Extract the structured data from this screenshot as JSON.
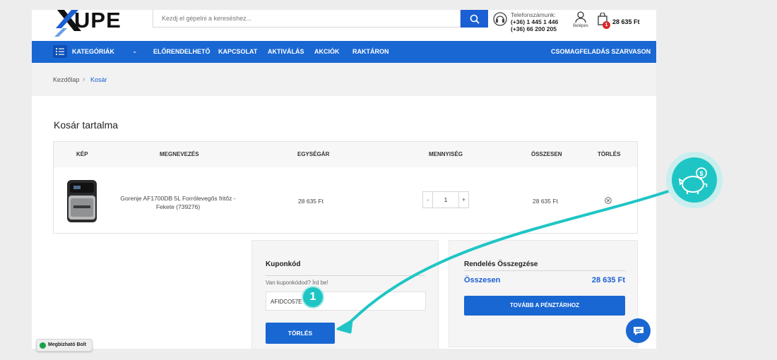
{
  "header": {
    "logo_text": "UPE",
    "search_placeholder": "Kezdj el gépelni a kereséshez...",
    "phone_label": "Telefonszámunk:",
    "phone_1": "(+36) 1 445 1 446",
    "phone_2": "(+36) 66 200 205",
    "login_label": "Belépés",
    "cart_count": "1",
    "cart_total": "28 635 Ft"
  },
  "nav": {
    "categories": "KATEGÓRIÁK",
    "items": [
      "ELŐRENDELHETŐ",
      "KAPCSOLAT",
      "AKTIVÁLÁS",
      "AKCIÓK",
      "RAKTÁRON"
    ],
    "right": "CSOMAGFELADÁS SZARVASON"
  },
  "breadcrumb": {
    "home": "Kezdőlap",
    "current": "Kosár"
  },
  "cart": {
    "title": "Kosár tartalma",
    "columns": [
      "KÉP",
      "MEGNEVEZÉS",
      "EGYSÉGÁR",
      "MENNYISÉG",
      "ÖSSZESEN",
      "TÖRLÉS"
    ],
    "rows": [
      {
        "name_line1": "Gorenje AF1700DB 5L Forrólevegős fritőz -",
        "name_line2": "Fekete (739276)",
        "unit_price": "28 635 Ft",
        "quantity": "1",
        "total": "28 635 Ft"
      }
    ]
  },
  "coupon": {
    "heading": "Kuponkód",
    "hint": "Van kuponkódod? Írd be!",
    "code": "AFIDCO57E",
    "button": "TÖRLÉS"
  },
  "summary": {
    "heading": "Rendelés Összegzése",
    "total_label": "Összesen",
    "total_value": "28 635 Ft",
    "checkout_button": "TOVÁBB A PÉNZTÁRHOZ"
  },
  "trust_badge": "Megbízható Bolt",
  "annotation": {
    "step": "1"
  },
  "colors": {
    "brand_blue": "#1967d2",
    "accent_teal": "#1fc5c5",
    "badge_red": "#d9262b"
  }
}
